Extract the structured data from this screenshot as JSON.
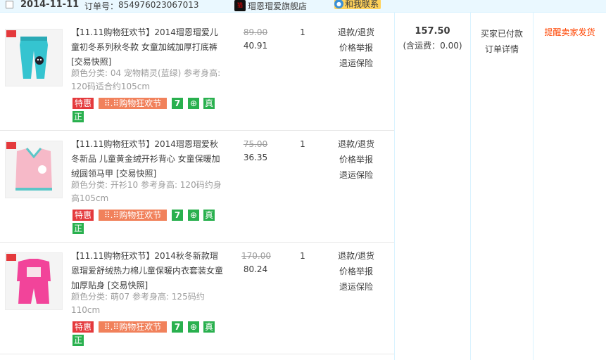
{
  "header": {
    "date": "2014-11-11",
    "order_label": "订单号：",
    "order_number": "854976023067013",
    "shop_name": "瑁恩瑁爱旗舰店",
    "contact_label": "和我联系"
  },
  "items": [
    {
      "title": "【11.11购物狂欢节】2014瑁恩瑁爱儿童初冬系列秋冬款 女童加绒加厚打底裤 [交易快照]",
      "attr": "颜色分类: 04 宠物精灵(蓝绿) 参考身高: 120码适合约105cm",
      "orig_price": "89.00",
      "price": "40.91",
      "qty": "1",
      "image_colors": {
        "bg": "#35c4d0",
        "accent": "#1f1f2a"
      },
      "icon": "pants-product-icon"
    },
    {
      "title": "【11.11购物狂欢节】2014瑁恩瑁爱秋冬新品 儿童黄金绒开衫背心 女童保暖加绒圆领马甲 [交易快照]",
      "attr": "颜色分类: 开衫10 参考身高: 120码约身高105cm",
      "orig_price": "75.00",
      "price": "36.35",
      "qty": "1",
      "image_colors": {
        "bg": "#f6b9c8",
        "accent": "#5cc6c8"
      },
      "icon": "vest-product-icon"
    },
    {
      "title": "【11.11购物狂欢节】2014秋冬新款瑁恩瑁爱舒绒热力棉儿童保暖内衣套装女童加厚贴身 [交易快照]",
      "attr": "颜色分类: 萌07 参考身高: 125码约110cm",
      "orig_price": "170.00",
      "price": "80.24",
      "qty": "1",
      "image_colors": {
        "bg": "#f2449a",
        "accent": "#f8e2ea"
      },
      "icon": "underwear-set-product-icon"
    }
  ],
  "tags": {
    "sale": "特惠",
    "festival": "⠿.⠿购物狂欢节",
    "seven": "7",
    "bag": "⊕",
    "real": "真",
    "zheng": "正"
  },
  "services": [
    "退款/退货",
    "价格举报",
    "退运保险"
  ],
  "total": {
    "amount": "157.50",
    "shipping": "(含运费：0.00)"
  },
  "status": {
    "line1": "买家已付款",
    "line2": "订单详情"
  },
  "action": {
    "remind": "提醒卖家发货"
  }
}
